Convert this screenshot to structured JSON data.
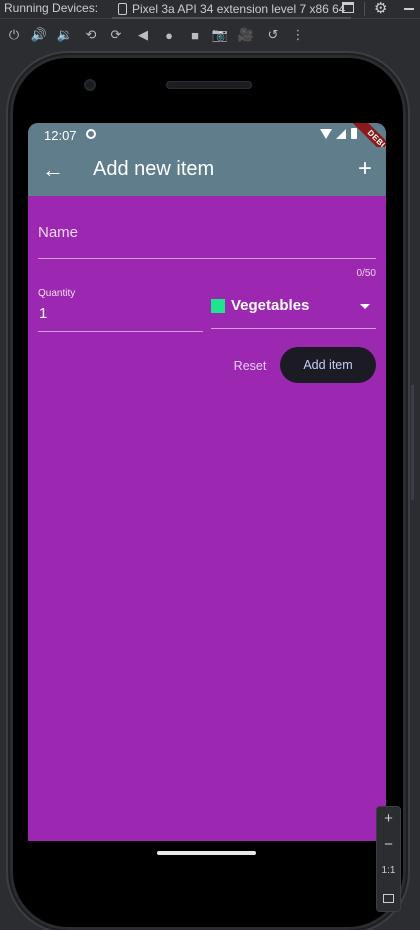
{
  "ide": {
    "running_devices_label": "Running Devices:",
    "device_tab_label": "Pixel 3a API 34 extension level 7 x86 64"
  },
  "toolbar": {
    "icons": [
      "power-icon",
      "volume-up-icon",
      "volume-down-icon",
      "rotate-left-icon",
      "rotate-right-icon",
      "back-icon",
      "home-icon",
      "overview-icon",
      "camera-icon",
      "video-icon",
      "snapshot-icon",
      "more-icon"
    ]
  },
  "phone": {
    "status_bar": {
      "time": "12:07",
      "debug_ribbon": "DEBUG"
    },
    "app_bar": {
      "title": "Add new item",
      "back_icon": "←",
      "add_icon": "+"
    },
    "form": {
      "name_label": "Name",
      "name_counter": "0/50",
      "quantity_label": "Quantity",
      "quantity_value": "1",
      "category_value": "Vegetables",
      "category_color": "#1de58e",
      "reset_label": "Reset",
      "add_label": "Add item"
    },
    "colors": {
      "app_bar": "#607d8b",
      "background": "#9c27b0",
      "add_button": "#1c1b23"
    }
  },
  "zoom_controls": {
    "zoom_in": "+",
    "zoom_out": "−",
    "actual_size": "1:1"
  }
}
